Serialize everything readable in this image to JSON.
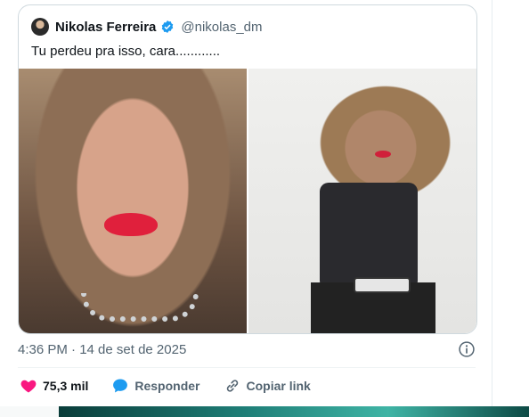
{
  "quote": {
    "author_name": "Nikolas Ferreira",
    "handle": "@nikolas_dm",
    "text": "Tu perdeu pra isso, cara............",
    "verified_color": "#1d9bf0"
  },
  "tweet": {
    "timestamp": "4:36 PM · 14 de set de 2025"
  },
  "actions": {
    "likes": "75,3 mil",
    "reply_label": "Responder",
    "copy_link_label": "Copiar link",
    "like_color": "#f91880",
    "reply_color": "#1d9bf0"
  },
  "icons": {
    "verified": "verified-badge-icon",
    "info": "info-icon",
    "like": "heart-icon",
    "reply": "speech-bubble-icon",
    "copy_link": "link-icon"
  }
}
